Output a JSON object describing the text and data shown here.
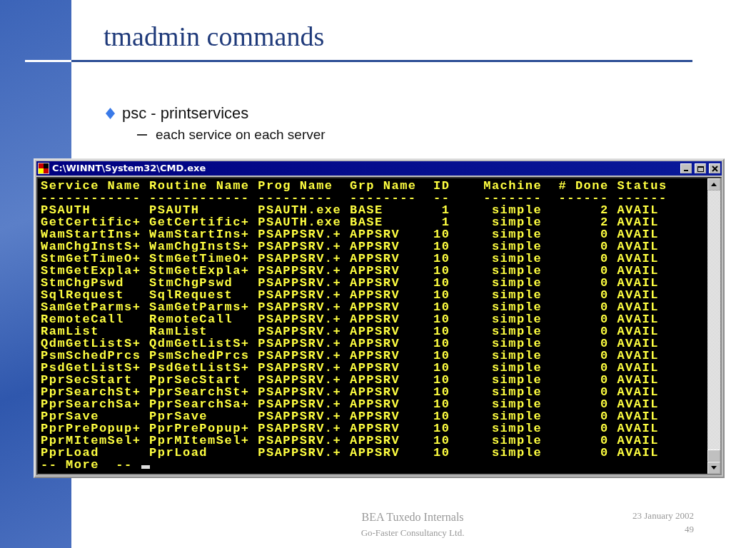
{
  "slide": {
    "title": "tmadmin commands",
    "bullets": [
      {
        "text": "psc - printservices",
        "children": [
          {
            "text": "each service on each server"
          }
        ]
      }
    ],
    "footer": {
      "title": "BEA Tuxedo Internals",
      "company": "Go-Faster Consultancy Ltd.",
      "date": "23 January 2002",
      "page": "49"
    }
  },
  "window": {
    "title": "C:\\WINNT\\System32\\CMD.exe",
    "console": {
      "columns": [
        "Service Name",
        "Routine Name",
        "Prog Name",
        "Grp Name",
        "ID",
        "Machine",
        "# Done",
        "Status"
      ],
      "separator_line": "------------ ------------ ---------  --------  --    -------  ------ ------",
      "rows": [
        [
          "PSAUTH",
          "PSAUTH",
          "PSAUTH.exe",
          "BASE",
          "1",
          "simple",
          "2",
          "AVAIL"
        ],
        [
          "GetCertific+",
          "GetCertific+",
          "PSAUTH.exe",
          "BASE",
          "1",
          "simple",
          "2",
          "AVAIL"
        ],
        [
          "WamStartIns+",
          "WamStartIns+",
          "PSAPPSRV.+",
          "APPSRV",
          "10",
          "simple",
          "0",
          "AVAIL"
        ],
        [
          "WamChgInstS+",
          "WamChgInstS+",
          "PSAPPSRV.+",
          "APPSRV",
          "10",
          "simple",
          "0",
          "AVAIL"
        ],
        [
          "StmGetTimeO+",
          "StmGetTimeO+",
          "PSAPPSRV.+",
          "APPSRV",
          "10",
          "simple",
          "0",
          "AVAIL"
        ],
        [
          "StmGetExpla+",
          "StmGetExpla+",
          "PSAPPSRV.+",
          "APPSRV",
          "10",
          "simple",
          "0",
          "AVAIL"
        ],
        [
          "StmChgPswd",
          "StmChgPswd",
          "PSAPPSRV.+",
          "APPSRV",
          "10",
          "simple",
          "0",
          "AVAIL"
        ],
        [
          "SqlRequest",
          "SqlRequest",
          "PSAPPSRV.+",
          "APPSRV",
          "10",
          "simple",
          "0",
          "AVAIL"
        ],
        [
          "SamGetParms+",
          "SamGetParms+",
          "PSAPPSRV.+",
          "APPSRV",
          "10",
          "simple",
          "0",
          "AVAIL"
        ],
        [
          "RemoteCall",
          "RemoteCall",
          "PSAPPSRV.+",
          "APPSRV",
          "10",
          "simple",
          "0",
          "AVAIL"
        ],
        [
          "RamList",
          "RamList",
          "PSAPPSRV.+",
          "APPSRV",
          "10",
          "simple",
          "0",
          "AVAIL"
        ],
        [
          "QdmGetListS+",
          "QdmGetListS+",
          "PSAPPSRV.+",
          "APPSRV",
          "10",
          "simple",
          "0",
          "AVAIL"
        ],
        [
          "PsmSchedPrcs",
          "PsmSchedPrcs",
          "PSAPPSRV.+",
          "APPSRV",
          "10",
          "simple",
          "0",
          "AVAIL"
        ],
        [
          "PsdGetListS+",
          "PsdGetListS+",
          "PSAPPSRV.+",
          "APPSRV",
          "10",
          "simple",
          "0",
          "AVAIL"
        ],
        [
          "PprSecStart",
          "PprSecStart",
          "PSAPPSRV.+",
          "APPSRV",
          "10",
          "simple",
          "0",
          "AVAIL"
        ],
        [
          "PprSearchSt+",
          "PprSearchSt+",
          "PSAPPSRV.+",
          "APPSRV",
          "10",
          "simple",
          "0",
          "AVAIL"
        ],
        [
          "PprSearchSa+",
          "PprSearchSa+",
          "PSAPPSRV.+",
          "APPSRV",
          "10",
          "simple",
          "0",
          "AVAIL"
        ],
        [
          "PprSave",
          "PprSave",
          "PSAPPSRV.+",
          "APPSRV",
          "10",
          "simple",
          "0",
          "AVAIL"
        ],
        [
          "PprPrePopup+",
          "PprPrePopup+",
          "PSAPPSRV.+",
          "APPSRV",
          "10",
          "simple",
          "0",
          "AVAIL"
        ],
        [
          "PprMItemSel+",
          "PprMItemSel+",
          "PSAPPSRV.+",
          "APPSRV",
          "10",
          "simple",
          "0",
          "AVAIL"
        ],
        [
          "PprLoad",
          "PprLoad",
          "PSAPPSRV.+",
          "APPSRV",
          "10",
          "simple",
          "0",
          "AVAIL"
        ]
      ],
      "prompt": "-- More  --"
    }
  }
}
